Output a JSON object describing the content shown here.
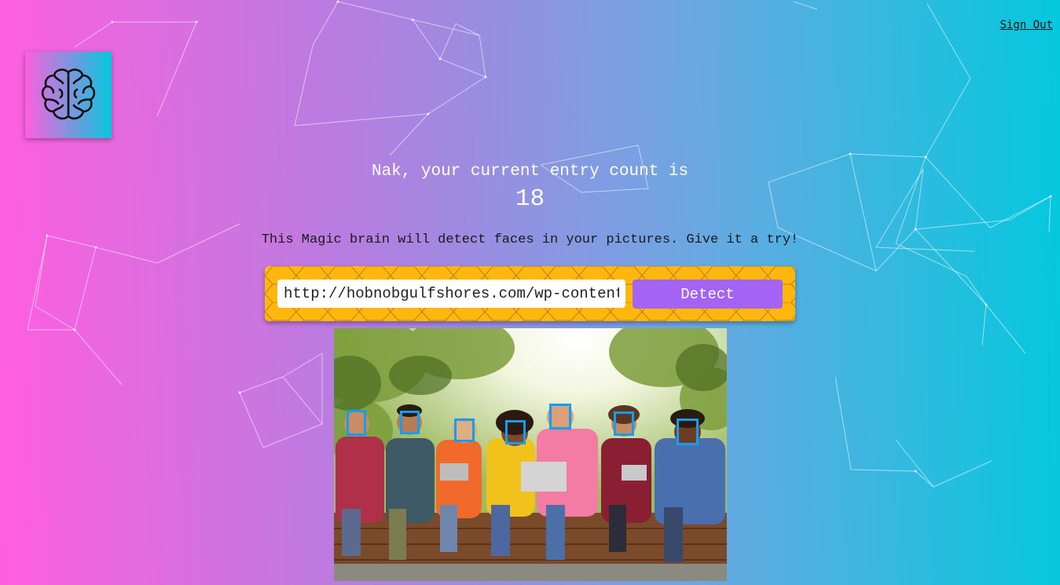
{
  "header": {
    "sign_out_label": "Sign Out"
  },
  "logo": {
    "icon": "brain-icon"
  },
  "rank": {
    "message": "Nak, your current entry count is",
    "count": "18"
  },
  "tagline": "This Magic brain will detect faces in your pictures. Give it a try!",
  "form": {
    "url_value": "http://hobnobgulfshores.com/wp-content/uploads/",
    "detect_label": "Detect"
  },
  "image": {
    "face_count": 7
  },
  "colors": {
    "gradient_start": "#ff5edf",
    "gradient_end": "#04c8de",
    "form_bg": "#ffb70e",
    "button": "#a463f2",
    "face_box": "#149df2"
  }
}
